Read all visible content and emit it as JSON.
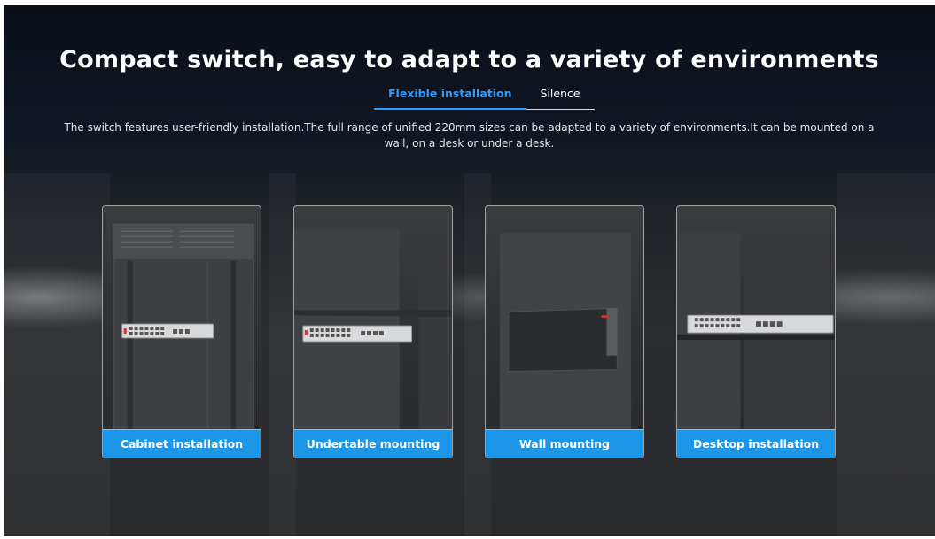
{
  "section": {
    "title": "Compact switch, easy to adapt to a variety of environments",
    "description": "The switch features user-friendly installation.The full range of unified 220mm sizes can be adapted to a variety of environments.It can be mounted on a wall, on a desk or under a desk."
  },
  "tabs": [
    {
      "label": "Flexible installation",
      "active": true
    },
    {
      "label": "Silence",
      "active": false
    }
  ],
  "cards": [
    {
      "label": "Cabinet installation",
      "image": "cabinet-rack-switch-image"
    },
    {
      "label": "Undertable mounting",
      "image": "undertable-switch-image"
    },
    {
      "label": "Wall mounting",
      "image": "wall-mounted-switch-image"
    },
    {
      "label": "Desktop installation",
      "image": "desktop-switch-image"
    }
  ],
  "colors": {
    "accent": "#1e96e8",
    "active_tab": "#2f9bff",
    "background": "#111722"
  }
}
